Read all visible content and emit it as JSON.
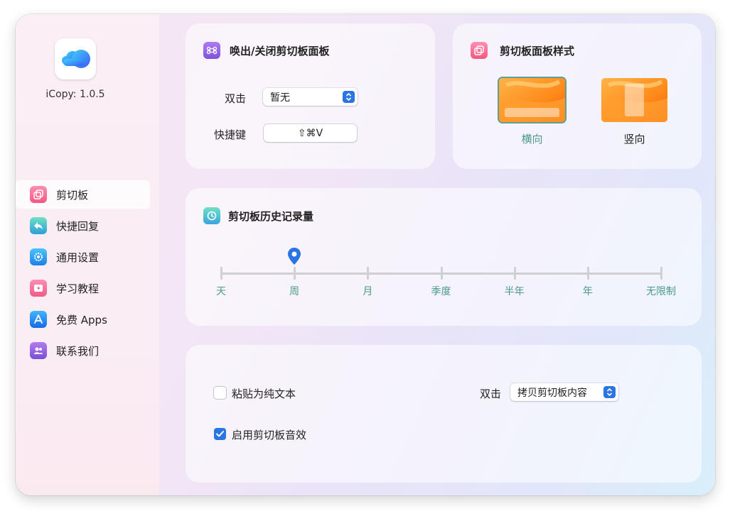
{
  "app": {
    "version_label": "iCopy: 1.0.5"
  },
  "sidebar": {
    "items": [
      {
        "label": "剪切板",
        "icon": "clipboard-icon",
        "active": true
      },
      {
        "label": "快捷回复",
        "icon": "reply-icon",
        "active": false
      },
      {
        "label": "通用设置",
        "icon": "gear-icon",
        "active": false
      },
      {
        "label": "学习教程",
        "icon": "video-icon",
        "active": false
      },
      {
        "label": "免费 Apps",
        "icon": "app-store-icon",
        "active": false
      },
      {
        "label": "联系我们",
        "icon": "contacts-icon",
        "active": false
      }
    ]
  },
  "toggle_panel": {
    "title": "唤出/关闭剪切板面板",
    "double_click_label": "双击",
    "double_click_value": "暂无",
    "hotkey_label": "快捷键",
    "hotkey_value": "⇧⌘V"
  },
  "panel_style": {
    "title": "剪切板面板样式",
    "options": [
      {
        "label": "横向",
        "selected": true
      },
      {
        "label": "竖向",
        "selected": false
      }
    ]
  },
  "history": {
    "title": "剪切板历史记录量",
    "ticks": [
      "天",
      "周",
      "月",
      "季度",
      "半年",
      "年",
      "无限制"
    ],
    "selected": "周"
  },
  "options": {
    "plain_text_label": "粘贴为纯文本",
    "plain_text_checked": false,
    "sound_label": "启用剪切板音效",
    "sound_checked": true,
    "double_click_label": "双击",
    "double_click_value": "拷贝剪切板内容"
  },
  "colors": {
    "accent": "#2a74e3",
    "teal_label": "#4b9a8c"
  }
}
